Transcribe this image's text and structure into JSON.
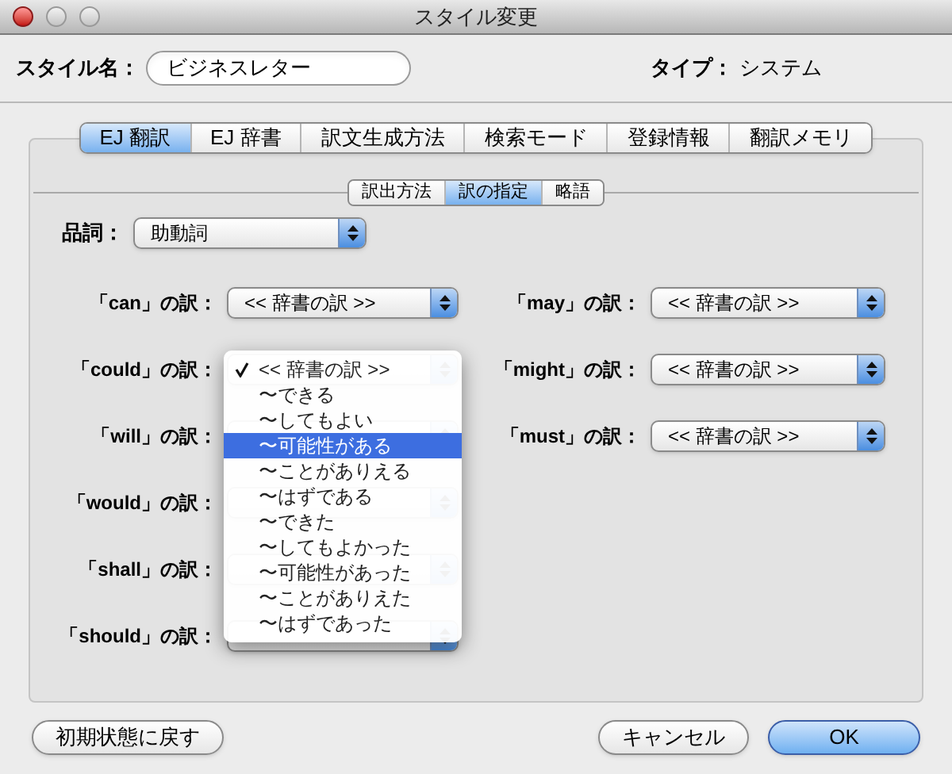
{
  "window": {
    "title": "スタイル変更"
  },
  "style_name": {
    "label": "スタイル名：",
    "value": "ビジネスレター"
  },
  "type": {
    "label": "タイプ：",
    "value": "システム"
  },
  "tabs": [
    {
      "label": "EJ 翻訳",
      "selected": true
    },
    {
      "label": "EJ 辞書",
      "selected": false
    },
    {
      "label": "訳文生成方法",
      "selected": false
    },
    {
      "label": "検索モード",
      "selected": false
    },
    {
      "label": "登録情報",
      "selected": false
    },
    {
      "label": "翻訳メモリ",
      "selected": false
    }
  ],
  "subtabs": [
    {
      "label": "訳出方法",
      "selected": false
    },
    {
      "label": "訳の指定",
      "selected": true
    },
    {
      "label": "略語",
      "selected": false
    }
  ],
  "part_of_speech": {
    "label": "品詞：",
    "value": "助動詞"
  },
  "left_rows": [
    {
      "label": "「can」の訳：",
      "value": "<< 辞書の訳 >>"
    },
    {
      "label": "「could」の訳："
    },
    {
      "label": "「will」の訳："
    },
    {
      "label": "「would」の訳："
    },
    {
      "label": "「shall」の訳："
    },
    {
      "label": "「should」の訳："
    }
  ],
  "right_rows": [
    {
      "label": "「may」の訳：",
      "value": "<< 辞書の訳 >>"
    },
    {
      "label": "「might」の訳：",
      "value": "<< 辞書の訳 >>"
    },
    {
      "label": "「must」の訳：",
      "value": "<< 辞書の訳 >>"
    }
  ],
  "menu": {
    "items": [
      {
        "label": "<< 辞書の訳 >>",
        "checked": true,
        "selected": false
      },
      {
        "label": "〜できる",
        "checked": false,
        "selected": false
      },
      {
        "label": "〜してもよい",
        "checked": false,
        "selected": false
      },
      {
        "label": "〜可能性がある",
        "checked": false,
        "selected": true
      },
      {
        "label": "〜ことがありえる",
        "checked": false,
        "selected": false
      },
      {
        "label": "〜はずである",
        "checked": false,
        "selected": false
      },
      {
        "label": "〜できた",
        "checked": false,
        "selected": false
      },
      {
        "label": "〜してもよかった",
        "checked": false,
        "selected": false
      },
      {
        "label": "〜可能性があった",
        "checked": false,
        "selected": false
      },
      {
        "label": "〜ことがありえた",
        "checked": false,
        "selected": false
      },
      {
        "label": "〜はずであった",
        "checked": false,
        "selected": false
      }
    ]
  },
  "buttons": [
    {
      "label": "初期状態に戻す",
      "kind": "normal"
    },
    {
      "label": "キャンセル",
      "kind": "normal"
    },
    {
      "label": "OK",
      "kind": "default"
    }
  ]
}
